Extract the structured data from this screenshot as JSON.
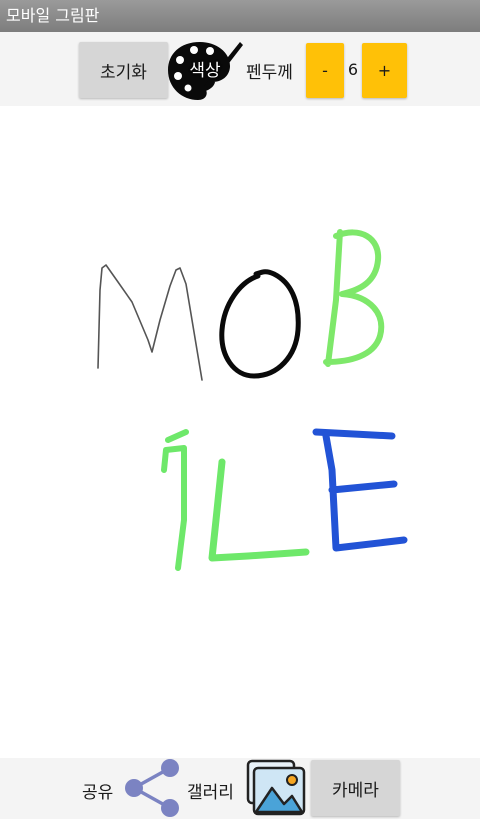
{
  "app": {
    "title": "모바일 그림판"
  },
  "toolbar": {
    "reset_label": "초기화",
    "color_label": "색상",
    "pen_width_label": "펜두께",
    "decrease_label": "-",
    "pen_width_value": "6",
    "increase_label": "+"
  },
  "bottom": {
    "share_label": "공유",
    "gallery_label": "갤러리",
    "camera_label": "카메라"
  },
  "drawing": {
    "background": "#ffffff",
    "strokes": [
      {
        "letter": "M",
        "color": "#555555"
      },
      {
        "letter": "O",
        "color": "#000000"
      },
      {
        "letter": "B",
        "color": "#7ee86a"
      },
      {
        "letter": "i",
        "color": "#6ee86a"
      },
      {
        "letter": "L",
        "color": "#6ee86a"
      },
      {
        "letter": "E",
        "color": "#2253d6"
      }
    ]
  },
  "colors": {
    "title_bar": "#8a8a8a",
    "button_gray": "#d6d6d6",
    "button_yellow": "#ffc107",
    "share_icon": "#7b83c2"
  },
  "icons": {
    "palette": "palette-icon",
    "share": "share-icon",
    "gallery": "gallery-icon"
  }
}
